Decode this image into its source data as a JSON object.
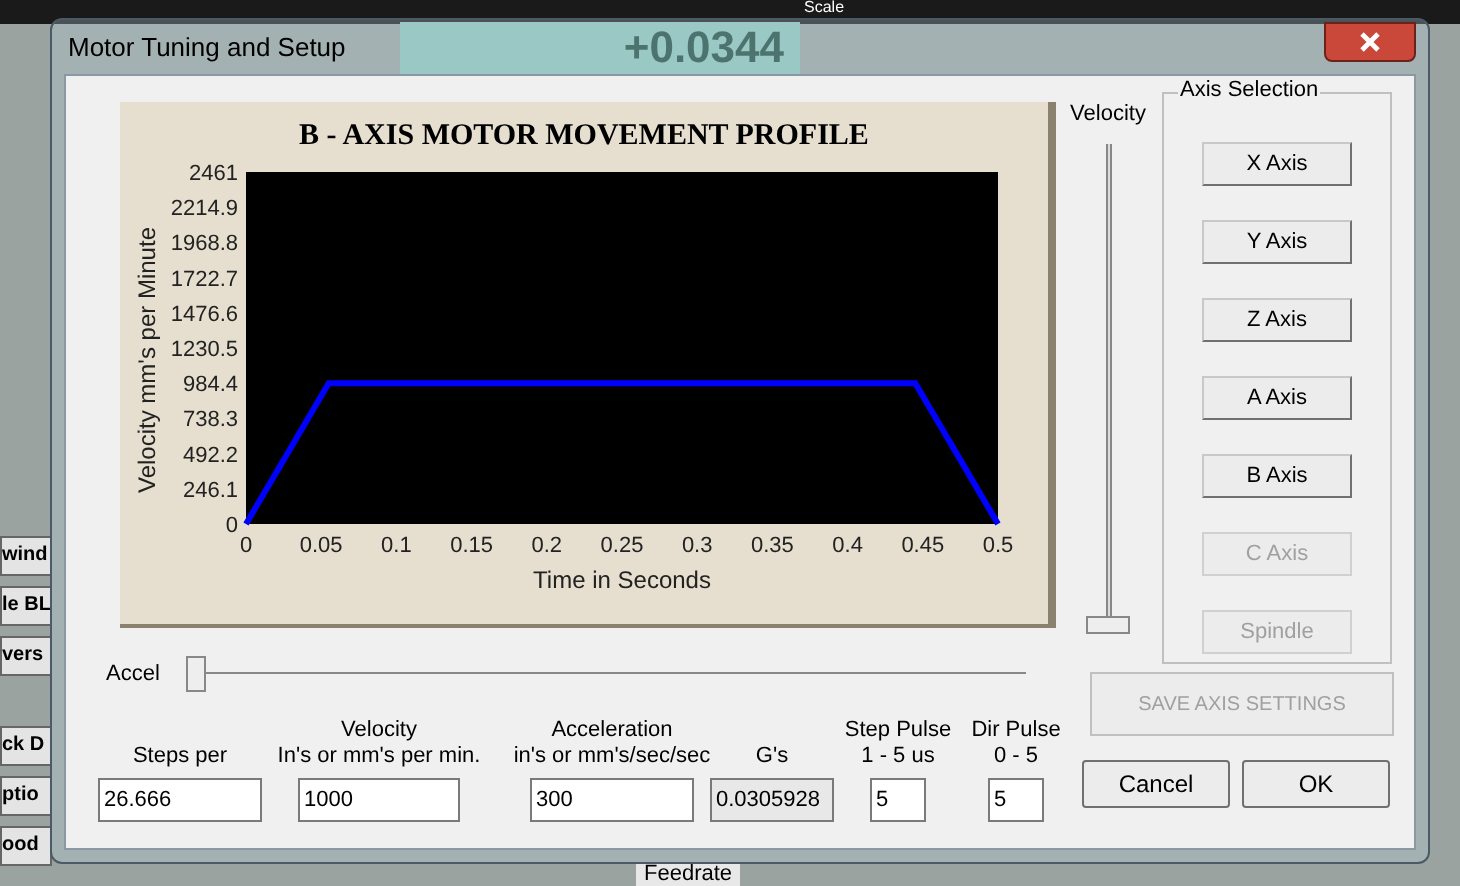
{
  "background": {
    "readout": "+0.0344",
    "top_label": "Scale",
    "left_buttons": [
      "wind",
      "le BL",
      "vers",
      "ck D",
      "ptio",
      "ood"
    ],
    "bottom_label": "Feedrate"
  },
  "window": {
    "title": "Motor Tuning and Setup"
  },
  "chart": {
    "chart_data": {
      "type": "line",
      "title": "B - AXIS MOTOR MOVEMENT PROFILE",
      "xlabel": "Time in Seconds",
      "ylabel": "Velocity mm's per Minute",
      "x": [
        0,
        0.055,
        0.445,
        0.5
      ],
      "series": [
        {
          "color": "#0000ff",
          "values": [
            0,
            984,
            984,
            0
          ]
        }
      ],
      "xlim": [
        0,
        0.5
      ],
      "ylim": [
        0,
        2461
      ],
      "xticks": [
        0,
        0.05,
        0.1,
        0.15,
        0.2,
        0.25,
        0.3,
        0.35,
        0.4,
        0.45,
        0.5
      ],
      "yticks": [
        0,
        246.1,
        492.2,
        738.3,
        984.4,
        1230.5,
        1476.6,
        1722.7,
        1968.8,
        2214.9,
        2461
      ]
    }
  },
  "velocity_slider": {
    "label": "Velocity",
    "level": 0
  },
  "axis_selection": {
    "title": "Axis Selection",
    "buttons": [
      {
        "label": "X Axis",
        "disabled": false
      },
      {
        "label": "Y Axis",
        "disabled": false
      },
      {
        "label": "Z Axis",
        "disabled": false
      },
      {
        "label": "A Axis",
        "disabled": false
      },
      {
        "label": "B Axis",
        "disabled": false
      },
      {
        "label": "C Axis",
        "disabled": true
      },
      {
        "label": "Spindle",
        "disabled": true
      }
    ]
  },
  "accel_slider": {
    "label": "Accel",
    "level": 0
  },
  "save_button": {
    "label": "SAVE AXIS SETTINGS",
    "disabled": true
  },
  "fields": [
    {
      "label": "Steps per",
      "value": "26.666",
      "readonly": false
    },
    {
      "label": "Velocity\nIn's or mm's per min.",
      "value": "1000",
      "readonly": false
    },
    {
      "label": "Acceleration\nin's or mm's/sec/sec",
      "value": "300",
      "readonly": false
    },
    {
      "label": "G's",
      "value": "0.0305928",
      "readonly": true
    },
    {
      "label": "Step Pulse\n1 - 5 us",
      "value": "5",
      "readonly": false
    },
    {
      "label": "Dir Pulse\n0 - 5",
      "value": "5",
      "readonly": false
    }
  ],
  "buttons": [
    "Cancel",
    "OK"
  ]
}
